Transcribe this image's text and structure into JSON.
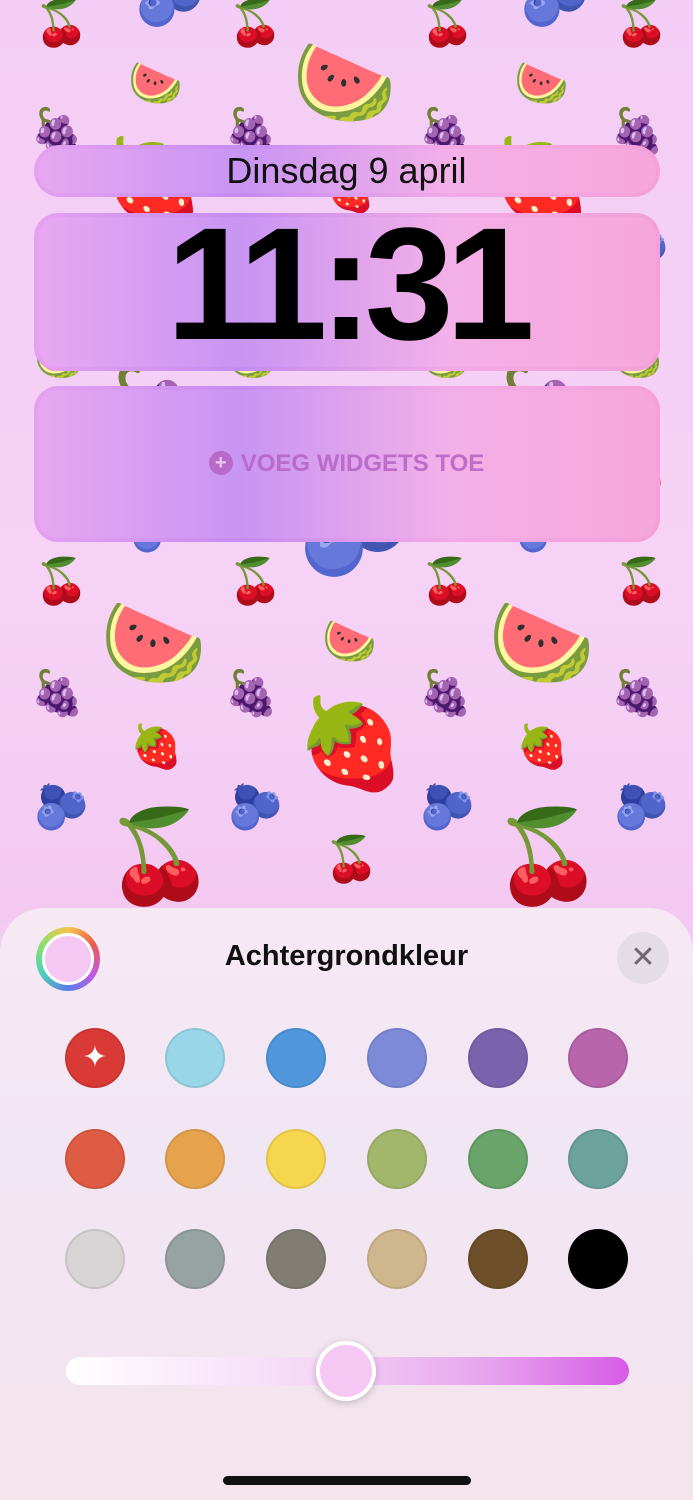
{
  "lockscreen": {
    "date": "Dinsdag 9 april",
    "time": "11:31",
    "add_widgets_icon": "plus-icon",
    "add_widgets": "VOEG WIDGETS TOE"
  },
  "wallpaper": {
    "description_icons": [
      "cherries-icon",
      "watermelon-icon",
      "grapes-icon",
      "strawberry-icon",
      "blueberries-icon"
    ]
  },
  "color_sheet": {
    "title": "Achtergrondkleur",
    "close_icon": "close-icon",
    "selected_color": "#f4c8f2",
    "swatches": [
      "#d93a35",
      "#98d6e8",
      "#4f96dc",
      "#7d8ad8",
      "#7a63ac",
      "#b865ac",
      "#de5c43",
      "#e6a24c",
      "#f5d64e",
      "#a3b76c",
      "#69a46a",
      "#6ca39c",
      "#d8d4d5",
      "#97a2a2",
      "#827d74",
      "#cfb78d",
      "#6d5029",
      "#000000"
    ],
    "special_swatch_icon": "sparkles-icon",
    "slider_value": 0.5,
    "slider_gradient": [
      "#ffffff",
      "#d65ce6"
    ]
  }
}
